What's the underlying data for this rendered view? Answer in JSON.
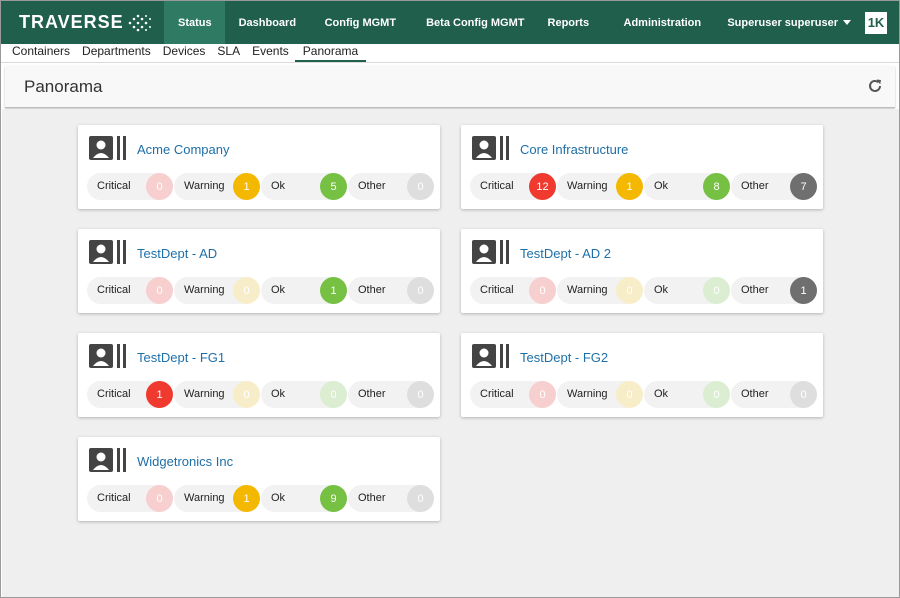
{
  "brand": "TRAVERSE",
  "nav": {
    "items": [
      "Status",
      "Dashboard",
      "Config MGMT",
      "Beta Config MGMT",
      "Reports",
      "Administration"
    ],
    "active": "Status"
  },
  "user": {
    "role": "Superuser",
    "name": "superuser",
    "logo": "1K"
  },
  "subnav": {
    "items": [
      "Containers",
      "Departments",
      "Devices",
      "SLA",
      "Events",
      "Panorama"
    ],
    "active": "Panorama"
  },
  "page": {
    "title": "Panorama",
    "refresh_icon": "refresh-icon"
  },
  "status_labels": {
    "critical": "Critical",
    "warning": "Warning",
    "ok": "Ok",
    "other": "Other"
  },
  "colors": {
    "critical": "#f03a2f",
    "critical_zero": "#f7cfcf",
    "warning": "#f5b800",
    "warning_zero": "#f7eec9",
    "ok": "#76c043",
    "ok_zero": "#dbeed1",
    "other": "#6f6f6f",
    "other_zero": "#dedede",
    "link": "#1e6fa8",
    "topbar": "#1f5f4c"
  },
  "departments": [
    {
      "name": "Acme Company",
      "critical": 0,
      "warning": 1,
      "ok": 5,
      "other": 0
    },
    {
      "name": "Core Infrastructure",
      "critical": 12,
      "warning": 1,
      "ok": 8,
      "other": 7
    },
    {
      "name": "TestDept - AD",
      "critical": 0,
      "warning": 0,
      "ok": 1,
      "other": 0
    },
    {
      "name": "TestDept - AD 2",
      "critical": 0,
      "warning": 0,
      "ok": 0,
      "other": 1
    },
    {
      "name": "TestDept - FG1",
      "critical": 1,
      "warning": 0,
      "ok": 0,
      "other": 0
    },
    {
      "name": "TestDept - FG2",
      "critical": 0,
      "warning": 0,
      "ok": 0,
      "other": 0
    },
    {
      "name": "Widgetronics Inc",
      "critical": 0,
      "warning": 1,
      "ok": 9,
      "other": 0
    }
  ]
}
